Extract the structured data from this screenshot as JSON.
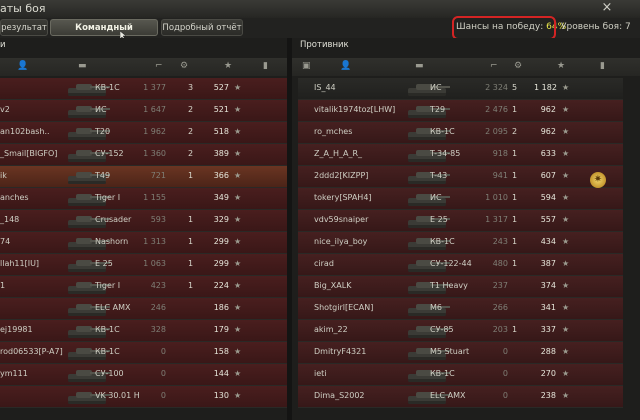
{
  "window": {
    "title": "аты боя",
    "close_label": "×"
  },
  "tabs": [
    {
      "label": "результат",
      "active": false
    },
    {
      "label": "Командный результат",
      "active": true
    },
    {
      "label": "Подробный отчёт",
      "active": false
    }
  ],
  "battle_info": {
    "chance_label": "Шансы на победу:",
    "chance_value": "64%",
    "level_text": "Уровень боя: 7"
  },
  "teams": {
    "left_title": "и",
    "right_title": "Противник"
  },
  "left_rows": [
    {
      "name": "",
      "tank": "КВ-1С",
      "xp": "1 377",
      "kills": "3",
      "points": "527"
    },
    {
      "name": "v2",
      "tank": "ИС",
      "xp": "1 647",
      "kills": "2",
      "points": "521"
    },
    {
      "name": "an102bash..",
      "tank": "T20",
      "xp": "1 962",
      "kills": "2",
      "points": "518"
    },
    {
      "name": "_Smail[BIGFO]",
      "tank": "СУ-152",
      "xp": "1 360",
      "kills": "2",
      "points": "389"
    },
    {
      "name": "ik",
      "tank": "T49",
      "xp": "721",
      "kills": "1",
      "points": "366"
    },
    {
      "name": "anches",
      "tank": "Tiger I",
      "xp": "1 155",
      "kills": "",
      "points": "349"
    },
    {
      "name": "_148",
      "tank": "Crusader",
      "xp": "593",
      "kills": "1",
      "points": "329"
    },
    {
      "name": "74",
      "tank": "Nashorn",
      "xp": "1 313",
      "kills": "1",
      "points": "299"
    },
    {
      "name": "llah11[IU]",
      "tank": "E 25",
      "xp": "1 063",
      "kills": "1",
      "points": "299"
    },
    {
      "name": "1",
      "tank": "Tiger I",
      "xp": "423",
      "kills": "1",
      "points": "224"
    },
    {
      "name": "",
      "tank": "ELC AMX",
      "xp": "246",
      "kills": "",
      "points": "186"
    },
    {
      "name": "ej19981",
      "tank": "КВ-1С",
      "xp": "328",
      "kills": "",
      "points": "179"
    },
    {
      "name": "rod06533[P-A7]",
      "tank": "КВ-1С",
      "xp": "0",
      "kills": "",
      "points": "158"
    },
    {
      "name": "ym111",
      "tank": "СУ-100",
      "xp": "0",
      "kills": "",
      "points": "144"
    },
    {
      "name": "",
      "tank": "VK 30.01 H",
      "xp": "0",
      "kills": "",
      "points": "130"
    }
  ],
  "right_rows": [
    {
      "name": "IS_44",
      "tank": "ИС",
      "xp": "2 324",
      "kills": "5",
      "points": "1 182"
    },
    {
      "name": "vitalik1974toz[LHW]",
      "tank": "T29",
      "xp": "2 476",
      "kills": "1",
      "points": "962"
    },
    {
      "name": "ro_mches",
      "tank": "КВ-1С",
      "xp": "2 095",
      "kills": "2",
      "points": "962"
    },
    {
      "name": "Z_A_H_A_R_",
      "tank": "T-34-85",
      "xp": "918",
      "kills": "1",
      "points": "633"
    },
    {
      "name": "2ddd2[KIZPP]",
      "tank": "T-43",
      "xp": "941",
      "kills": "1",
      "points": "607"
    },
    {
      "name": "tokery[SPAH4]",
      "tank": "ИС",
      "xp": "1 010",
      "kills": "1",
      "points": "594"
    },
    {
      "name": "vdv59snaiper",
      "tank": "E 25",
      "xp": "1 317",
      "kills": "1",
      "points": "557"
    },
    {
      "name": "nice_ilya_boy",
      "tank": "КВ-1С",
      "xp": "243",
      "kills": "1",
      "points": "434"
    },
    {
      "name": "cirad",
      "tank": "СУ-122-44",
      "xp": "480",
      "kills": "1",
      "points": "387"
    },
    {
      "name": "Big_XALK",
      "tank": "T1 Heavy",
      "xp": "237",
      "kills": "",
      "points": "374"
    },
    {
      "name": "Shotgirl[ECAN]",
      "tank": "M6",
      "xp": "266",
      "kills": "",
      "points": "341"
    },
    {
      "name": "akim_22",
      "tank": "СУ-85",
      "xp": "203",
      "kills": "1",
      "points": "337"
    },
    {
      "name": "DmitryF4321",
      "tank": "M5 Stuart",
      "xp": "0",
      "kills": "",
      "points": "288"
    },
    {
      "name": "ieti",
      "tank": "КВ-1С",
      "xp": "0",
      "kills": "",
      "points": "270"
    },
    {
      "name": "Dima_S2002",
      "tank": "ELC AMX",
      "xp": "0",
      "kills": "",
      "points": "238"
    }
  ],
  "colors": {
    "enemy_row": "#461f1f",
    "highlight_row": "#6a3522",
    "chance_frame": "#d42424",
    "chance_value": "#e8e64a"
  },
  "icons": {
    "column_player": "person-icon",
    "column_tank": "tank-icon",
    "column_damage": "damage-icon",
    "column_kills": "kill-icon",
    "column_points": "star-icon",
    "column_status": "status-icon",
    "medal": "medal-icon"
  }
}
